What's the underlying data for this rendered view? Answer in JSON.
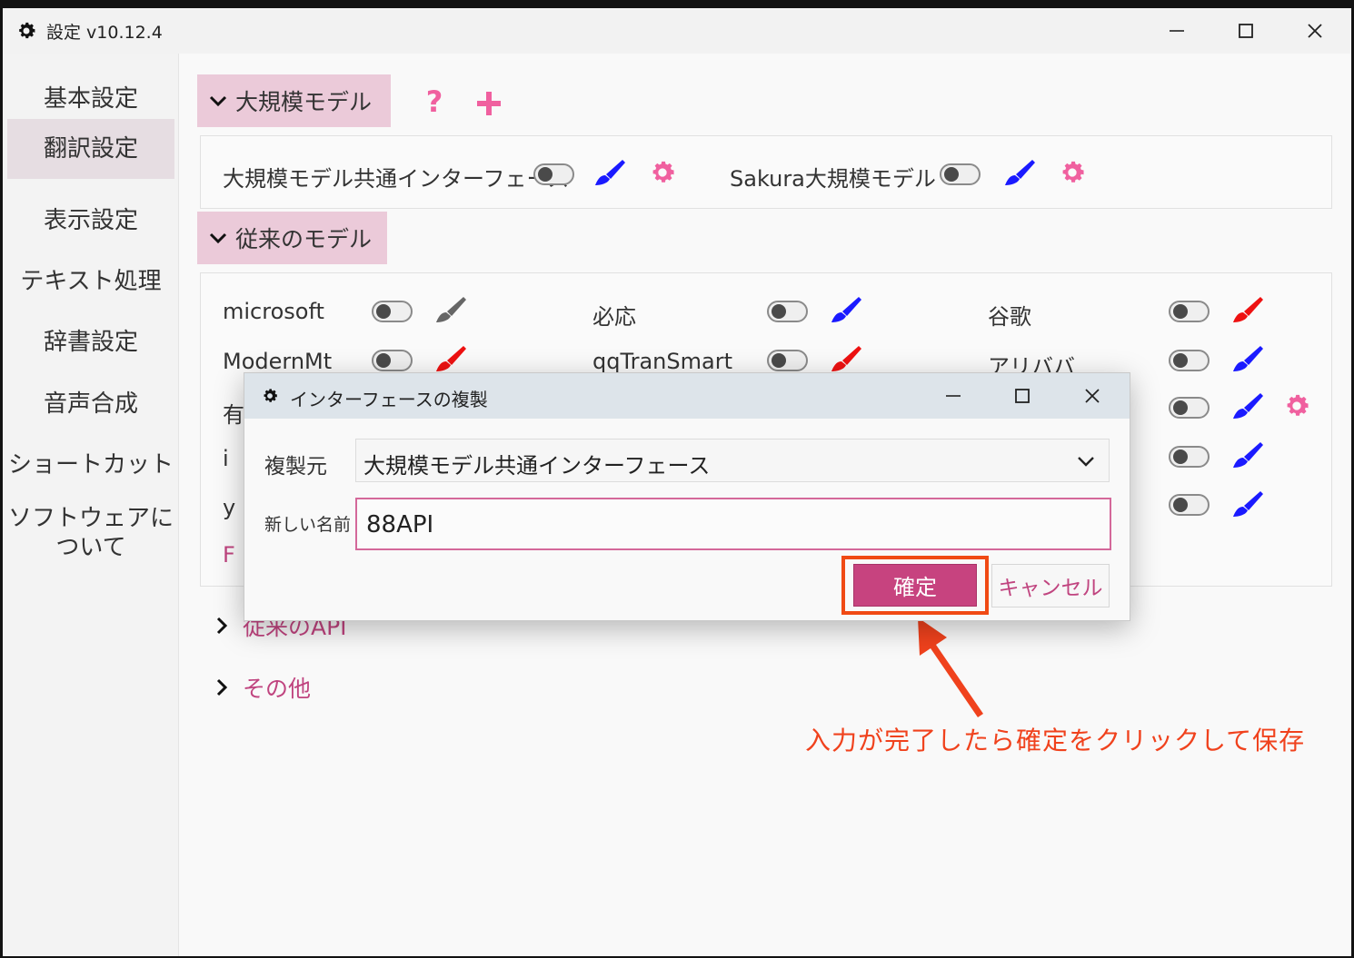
{
  "window": {
    "title": "設定 v10.12.4"
  },
  "sidebar": {
    "items": [
      {
        "label": "基本設定"
      },
      {
        "label": "翻訳設定"
      },
      {
        "label": "表示設定"
      },
      {
        "label": "テキスト処理"
      },
      {
        "label": "辞書設定"
      },
      {
        "label": "音声合成"
      },
      {
        "label": "ショートカット"
      },
      {
        "label_line1": "ソフトウェアに",
        "label_line2": "ついて"
      }
    ]
  },
  "llm_group": {
    "title": "大規模モデル",
    "items": [
      {
        "label": "大規模モデル共通インターフェース",
        "enabled": false,
        "brush_color": "#1a1aff"
      },
      {
        "label": "Sakura大規模モデル",
        "enabled": false,
        "brush_color": "#1a1aff"
      }
    ]
  },
  "legacy_group": {
    "title": "従来のモデル",
    "items": [
      {
        "label": "microsoft",
        "enabled": false,
        "brush_color": "#666666"
      },
      {
        "label": "必応",
        "enabled": false,
        "brush_color": "#1a1aff"
      },
      {
        "label": "谷歌",
        "enabled": false,
        "brush_color": "#ee1111"
      },
      {
        "label": "ModernMt",
        "enabled": false,
        "brush_color": "#ee1111"
      },
      {
        "label": "qqTranSmart",
        "enabled": false,
        "brush_color": "#ee1111"
      },
      {
        "label": "アリババ",
        "enabled": false,
        "brush_color": "#1a1aff"
      }
    ],
    "partial_labels": [
      "有",
      "i",
      "y",
      "F"
    ]
  },
  "collapsed_groups": [
    {
      "label": "従来のAPI"
    },
    {
      "label": "その他"
    }
  ],
  "dialog": {
    "title": "インターフェースの複製",
    "source_label": "複製元",
    "source_value": "大規模モデル共通インターフェース",
    "name_label": "新しい名前",
    "name_value": "88API",
    "confirm_label": "確定",
    "cancel_label": "キャンセル"
  },
  "annotation": {
    "text": "入力が完了したら確定をクリックして保存"
  },
  "colors": {
    "accent": "#c7437f",
    "header_bg": "#ebcad9",
    "icon_pink": "#f0609f",
    "highlight_red": "#f04a14"
  }
}
